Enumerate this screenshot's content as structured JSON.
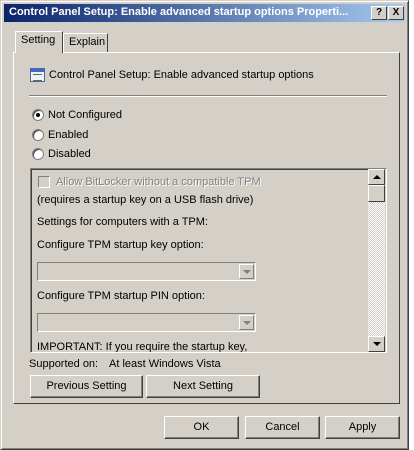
{
  "window": {
    "title": "Control Panel Setup: Enable advanced startup options Properti...",
    "help_button": "?",
    "close_button": "X"
  },
  "tabs": [
    {
      "label": "Setting",
      "active": true
    },
    {
      "label": "Explain",
      "active": false
    }
  ],
  "policy": {
    "icon": "policy-setting-icon",
    "name": "Control Panel Setup: Enable advanced startup options"
  },
  "state_options": [
    {
      "label": "Not Configured",
      "selected": true
    },
    {
      "label": "Enabled",
      "selected": false
    },
    {
      "label": "Disabled",
      "selected": false
    }
  ],
  "options": {
    "allow_bitlocker_label": "Allow BitLocker without a compatible TPM",
    "requires_key_note": "(requires a startup key on a USB flash drive)",
    "tpm_settings_heading": "Settings for computers with a TPM:",
    "tpm_startup_key_label": "Configure TPM startup key option:",
    "tpm_startup_key_value": "",
    "tpm_startup_pin_label": "Configure TPM startup PIN option:",
    "tpm_startup_pin_value": "",
    "important_text": "IMPORTANT: If you require the startup key,"
  },
  "supported": {
    "label": "Supported on:",
    "value": "At least Windows Vista"
  },
  "nav": {
    "previous": "Previous Setting",
    "next": "Next Setting"
  },
  "dialog_buttons": {
    "ok": "OK",
    "cancel": "Cancel",
    "apply": "Apply"
  }
}
